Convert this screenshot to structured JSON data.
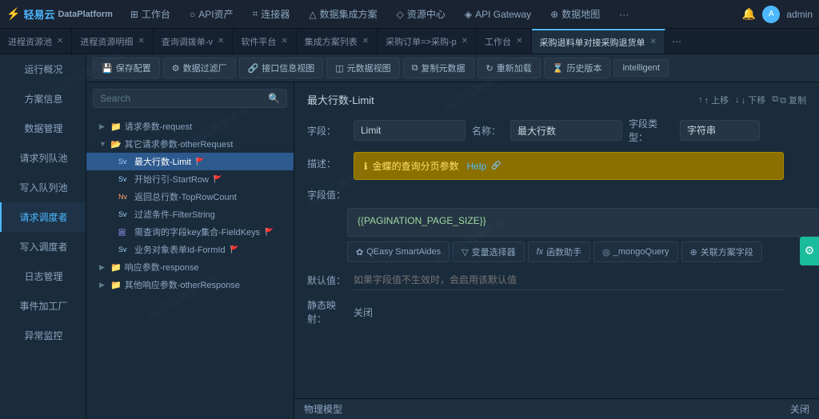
{
  "app": {
    "logo": "轻易云",
    "subtitle": "DataPlatform"
  },
  "topnav": {
    "items": [
      {
        "label": "工作台",
        "icon": "⊞"
      },
      {
        "label": "API资产",
        "icon": "○"
      },
      {
        "label": "连接器",
        "icon": "⌗"
      },
      {
        "label": "数据集成方案",
        "icon": "△"
      },
      {
        "label": "资源中心",
        "icon": "◇"
      },
      {
        "label": "API Gateway",
        "icon": "◈"
      },
      {
        "label": "数据地图",
        "icon": "⊕"
      }
    ],
    "more": "···",
    "admin": "admin"
  },
  "tabs": [
    {
      "label": "进程资源池",
      "active": false
    },
    {
      "label": "进程资源明细",
      "active": false
    },
    {
      "label": "查询调拨单-v",
      "active": false
    },
    {
      "label": "软件平台",
      "active": false
    },
    {
      "label": "集成方案列表",
      "active": false
    },
    {
      "label": "采购订单=>采购-p",
      "active": false
    },
    {
      "label": "工作台",
      "active": false
    },
    {
      "label": "采购退料单对接采购退货单",
      "active": true
    }
  ],
  "toolbar": {
    "save": "保存配置",
    "filter": "数据过滤厂",
    "interface": "接口信息视图",
    "metadata": "元数据视图",
    "copy": "复制元数据",
    "reload": "重新加载",
    "history": "历史版本",
    "intelligent": "intelligent"
  },
  "sidebar": {
    "items": [
      {
        "label": "运行概况",
        "active": false
      },
      {
        "label": "方案信息",
        "active": false
      },
      {
        "label": "数据管理",
        "active": false
      },
      {
        "label": "请求列队池",
        "active": false
      },
      {
        "label": "写入队列池",
        "active": false
      },
      {
        "label": "请求调度者",
        "active": true
      },
      {
        "label": "写入调度者",
        "active": false
      },
      {
        "label": "日志管理",
        "active": false
      },
      {
        "label": "事件加工厂",
        "active": false
      },
      {
        "label": "异常监控",
        "active": false
      }
    ]
  },
  "search": {
    "placeholder": "Search"
  },
  "tree": {
    "items": [
      {
        "id": "req-params",
        "label": "请求参数-request",
        "indent": 1,
        "type": "folder",
        "expanded": false
      },
      {
        "id": "other-req",
        "label": "其它请求参数-otherRequest",
        "indent": 1,
        "type": "folder",
        "expanded": true
      },
      {
        "id": "limit",
        "label": "最大行数-Limit",
        "indent": 2,
        "type": "string",
        "flag": true,
        "active": true
      },
      {
        "id": "startrow",
        "label": "开始行引-StartRow",
        "indent": 2,
        "type": "string",
        "flag": true
      },
      {
        "id": "toprowcount",
        "label": "返回总行数-TopRowCount",
        "indent": 2,
        "type": "number"
      },
      {
        "id": "filterstring",
        "label": "过滤条件-FilterString",
        "indent": 2,
        "type": "string"
      },
      {
        "id": "fieldkeys",
        "label": "需查询的字段key集合-FieldKeys",
        "indent": 2,
        "type": "array",
        "flag": true
      },
      {
        "id": "formid",
        "label": "业务对象表单Id-FormId",
        "indent": 2,
        "type": "string",
        "flag": true
      },
      {
        "id": "response",
        "label": "响应参数-response",
        "indent": 1,
        "type": "folder",
        "expanded": false
      },
      {
        "id": "other-resp",
        "label": "其他响应参数-otherResponse",
        "indent": 1,
        "type": "folder"
      }
    ]
  },
  "form": {
    "title": "最大行数-Limit",
    "actions": {
      "up": "↑ 上移",
      "down": "↓ 下移",
      "copy": "⧉ 复制"
    },
    "field_label": "字段：",
    "field_value": "Limit",
    "name_label": "名称：",
    "name_value": "最大行数",
    "type_label": "字段类型：",
    "type_value": "字符串",
    "desc_label": "描述：",
    "desc_icon": "ℹ",
    "desc_text": "金蝶的查询分页参数",
    "desc_help": "Help",
    "value_label": "字段值：",
    "value_text": "{{PAGINATION_PAGE_SIZE}}",
    "tools": [
      {
        "icon": "✿",
        "label": "QEasy SmartAides"
      },
      {
        "icon": "▽",
        "label": "变量选择器"
      },
      {
        "icon": "fx",
        "label": "函数助手"
      },
      {
        "icon": "◎",
        "label": "_mongoQuery"
      },
      {
        "icon": "⊕",
        "label": "关联方案字段"
      }
    ],
    "default_label": "默认值：",
    "default_placeholder": "如果字段值不生效时，会启用该默认值",
    "static_label": "静态映射：",
    "static_value": "关闭",
    "bottom_label": "物理模型",
    "bottom_close": "关闭"
  },
  "watermark": "轻易云数据中台"
}
